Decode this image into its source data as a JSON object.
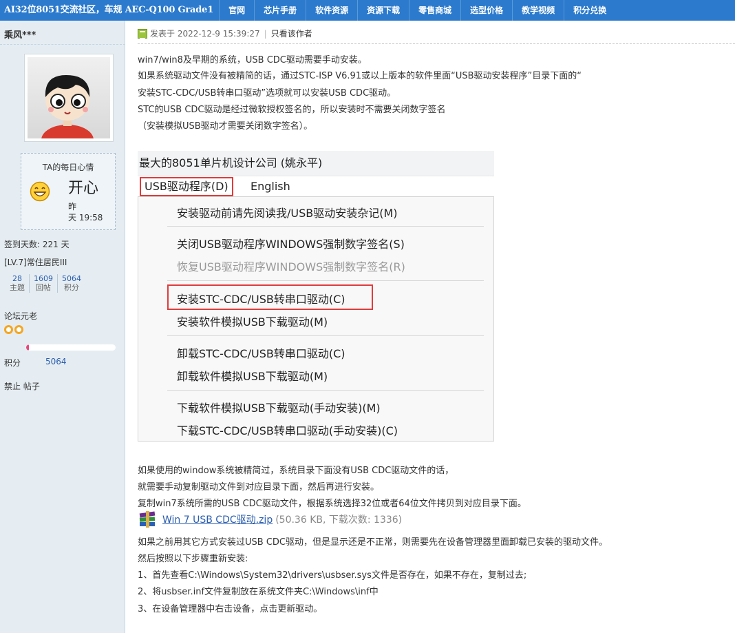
{
  "nav": {
    "brand": "AI32位8051交流社区，车规 AEC-Q100 Grade1",
    "items": [
      "官网",
      "芯片手册",
      "软件资源",
      "资源下载",
      "零售商城",
      "选型价格",
      "教学视频",
      "积分兑换"
    ]
  },
  "user": {
    "name": "乘风***",
    "mood_title": "TA的每日心情",
    "mood": "开心",
    "mood_time_line1": "昨",
    "mood_time_line2": "天 19:58",
    "checkin": "签到天数: 221 天",
    "level": "[LV.7]常住居民III",
    "stats": [
      {
        "num": "28",
        "label": "主题"
      },
      {
        "num": "1609",
        "label": "回帖"
      },
      {
        "num": "5064",
        "label": "积分"
      }
    ],
    "group": "论坛元老",
    "progress": 0.02,
    "score_label": "积分",
    "score_value": "5064",
    "ban": "禁止 帖子",
    "star_color": "#f5a623",
    "progress_color": "#e5487b"
  },
  "post": {
    "date": "发表于 2022-12-9 15:39:27",
    "sep": "|",
    "only_author": "只看该作者",
    "intro": [
      "win7/win8及早期的系统，USB CDC驱动需要手动安装。",
      "如果系统驱动文件没有被精简的话，通过STC-ISP V6.91或以上版本的软件里面“USB驱动安装程序”目录下面的“",
      "安装STC-CDC/USB转串口驱动”选项就可以安装USB CDC驱动。",
      "STC的USB CDC驱动是经过微软授权签名的，所以安装时不需要关闭数字签名",
      "（安装模拟USB驱动才需要关闭数字签名）。"
    ],
    "screenshot": {
      "title": "最大的8051单片机设计公司 (姚永平)",
      "menu_usb": "USB驱动程序(D)",
      "menu_en": "English",
      "items": [
        {
          "label": "安装驱动前请先阅读我/USB驱动安装杂记(M)",
          "disabled": false
        },
        {
          "label": "关闭USB驱动程序WINDOWS强制数字签名(S)",
          "disabled": false
        },
        {
          "label": "恢复USB驱动程序WINDOWS强制数字签名(R)",
          "disabled": true
        },
        {
          "label": "安装STC-CDC/USB转串口驱动(C)",
          "disabled": false
        },
        {
          "label": "安装软件模拟USB下载驱动(M)",
          "disabled": false
        },
        {
          "label": "卸载STC-CDC/USB转串口驱动(C)",
          "disabled": false
        },
        {
          "label": "卸载软件模拟USB下载驱动(M)",
          "disabled": false
        },
        {
          "label": "下载软件模拟USB下载驱动(手动安装)(M)",
          "disabled": false
        },
        {
          "label": "下载STC-CDC/USB转串口驱动(手动安装)(C)",
          "disabled": false
        }
      ]
    },
    "middle": [
      "如果使用的window系统被精简过，系统目录下面没有USB CDC驱动文件的话，",
      "就需要手动复制驱动文件到对应目录下面，然后再进行安装。",
      "复制win7系统所需的USB CDC驱动文件，根据系统选择32位或者64位文件拷贝到对应目录下面。"
    ],
    "attachment": {
      "name": "Win 7 USB CDC驱动.zip",
      "info": "(50.36 KB, 下载次数: 1336)"
    },
    "outro": [
      "如果之前用其它方式安装过USB CDC驱动，但是显示还是不正常，则需要先在设备管理器里面卸载已安装的驱动文件。",
      "然后按照以下步骤重新安装:",
      "1、首先查看C:\\Windows\\System32\\drivers\\usbser.sys文件是否存在，如果不存在，复制过去;",
      "2、将usbser.inf文件复制放在系统文件夹C:\\Windows\\inf中",
      "3、在设备管理器中右击设备，点击更新驱动。"
    ]
  }
}
